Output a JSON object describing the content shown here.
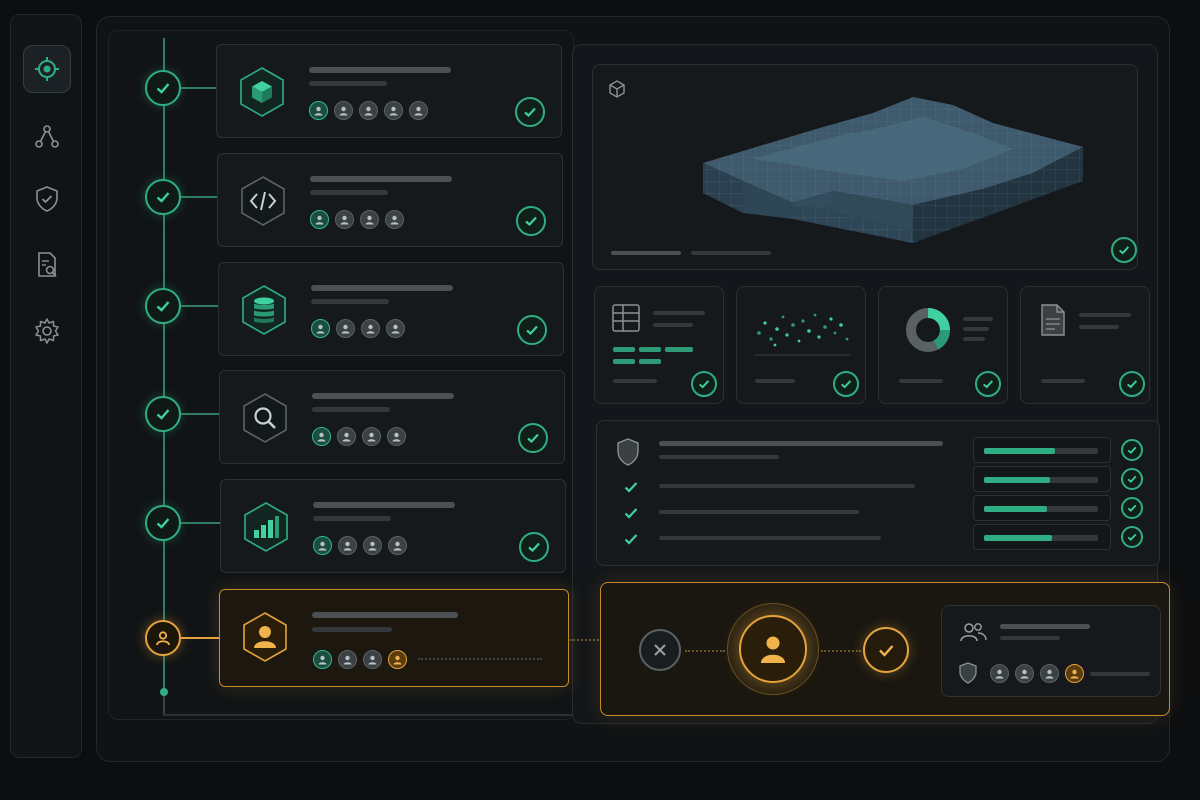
{
  "colors": {
    "accent_green": "#2fae84",
    "accent_orange": "#e3a23a",
    "background": "#0c0e10",
    "panel": "#16191c"
  },
  "sidebar": {
    "items": [
      {
        "icon": "target-icon",
        "active": true
      },
      {
        "icon": "network-icon",
        "active": false
      },
      {
        "icon": "shield-check-icon",
        "active": false
      },
      {
        "icon": "document-search-icon",
        "active": false
      },
      {
        "icon": "gear-icon",
        "active": false
      }
    ]
  },
  "pipeline": {
    "steps": [
      {
        "icon": "cube-icon",
        "status": "complete",
        "assignees": 5,
        "pending_assignees": 0
      },
      {
        "icon": "code-icon",
        "status": "complete",
        "assignees": 4,
        "pending_assignees": 0
      },
      {
        "icon": "database-icon",
        "status": "complete",
        "assignees": 4,
        "pending_assignees": 0
      },
      {
        "icon": "search-icon",
        "status": "complete",
        "assignees": 4,
        "pending_assignees": 0
      },
      {
        "icon": "bar-chart-icon",
        "status": "complete",
        "assignees": 4,
        "pending_assignees": 0
      },
      {
        "icon": "user-icon",
        "status": "awaiting-approval",
        "assignees": 4,
        "pending_assignees": 1
      }
    ]
  },
  "preview": {
    "icon": "cube-outline-icon",
    "status": "complete"
  },
  "outputs": [
    {
      "icon": "table-icon",
      "status": "complete"
    },
    {
      "icon": "scatter-plot-icon",
      "status": "complete"
    },
    {
      "icon": "donut-chart-icon",
      "status": "complete"
    },
    {
      "icon": "file-icon",
      "status": "complete"
    }
  ],
  "validation": {
    "icon": "shield-icon",
    "checks": 3,
    "metrics": [
      {
        "level": 0.62
      },
      {
        "level": 0.58
      },
      {
        "level": 0.55
      },
      {
        "level": 0.6
      }
    ]
  },
  "approval": {
    "reject_icon": "close-icon",
    "approver_icon": "user-icon",
    "approve_icon": "check-icon",
    "team_icon": "users-icon"
  }
}
